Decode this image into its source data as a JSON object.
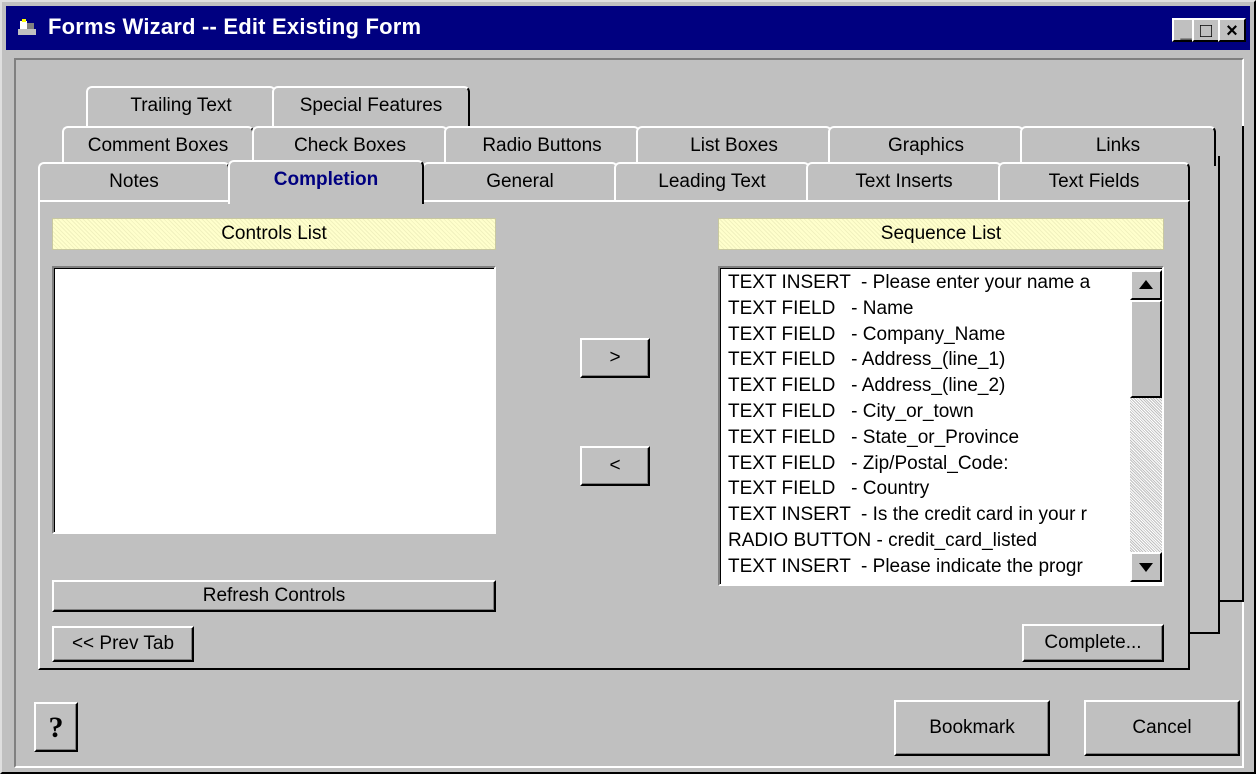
{
  "window": {
    "title": "Forms Wizard -- Edit Existing Form",
    "controls": {
      "minimize": "_",
      "maximize": "□",
      "close": "×"
    }
  },
  "tabs": {
    "row1": [
      "Trailing Text",
      "Special Features"
    ],
    "row2": [
      "Comment Boxes",
      "Check Boxes",
      "Radio Buttons",
      "List Boxes",
      "Graphics",
      "Links"
    ],
    "row3": [
      "Notes",
      "Completion",
      "General",
      "Leading Text",
      "Text Inserts",
      "Text Fields"
    ],
    "active": "Completion"
  },
  "completion": {
    "controls_list_label": "Controls List",
    "sequence_list_label": "Sequence List",
    "move_right_label": ">",
    "move_left_label": "<",
    "refresh_label": "Refresh Controls",
    "prev_tab_label": "<< Prev Tab",
    "complete_label": "Complete...",
    "sequence_items": [
      "TEXT INSERT  - Please enter your name a",
      "TEXT FIELD   - Name",
      "TEXT FIELD   - Company_Name",
      "TEXT FIELD   - Address_(line_1)",
      "TEXT FIELD   - Address_(line_2)",
      "TEXT FIELD   - City_or_town",
      "TEXT FIELD   - State_or_Province",
      "TEXT FIELD   - Zip/Postal_Code:",
      "TEXT FIELD   - Country",
      "TEXT INSERT  - Is the credit card in your r",
      "RADIO BUTTON - credit_card_listed",
      "TEXT INSERT  - Please indicate the progr"
    ]
  },
  "footer": {
    "help_icon": "question-mark",
    "bookmark_label": "Bookmark",
    "cancel_label": "Cancel"
  }
}
